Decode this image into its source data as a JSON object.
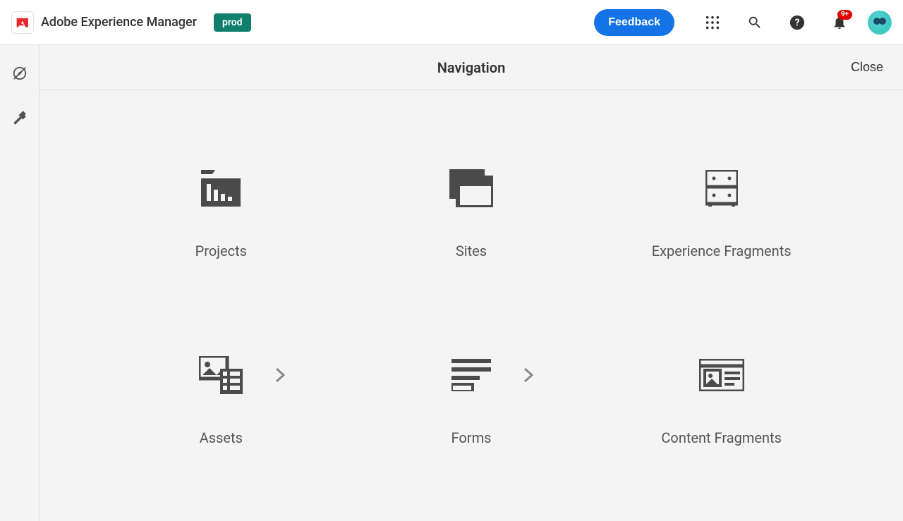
{
  "header": {
    "app_title": "Adobe Experience Manager",
    "env_badge": "prod",
    "feedback_label": "Feedback",
    "notification_badge": "9+"
  },
  "subheader": {
    "title": "Navigation",
    "close_label": "Close"
  },
  "tiles": [
    {
      "label": "Projects",
      "icon": "projects-icon",
      "has_chevron": false
    },
    {
      "label": "Sites",
      "icon": "sites-icon",
      "has_chevron": false
    },
    {
      "label": "Experience Fragments",
      "icon": "fragments-icon",
      "has_chevron": false
    },
    {
      "label": "Assets",
      "icon": "assets-icon",
      "has_chevron": true
    },
    {
      "label": "Forms",
      "icon": "forms-icon",
      "has_chevron": true
    },
    {
      "label": "Content Fragments",
      "icon": "content-fragments-icon",
      "has_chevron": false
    }
  ]
}
